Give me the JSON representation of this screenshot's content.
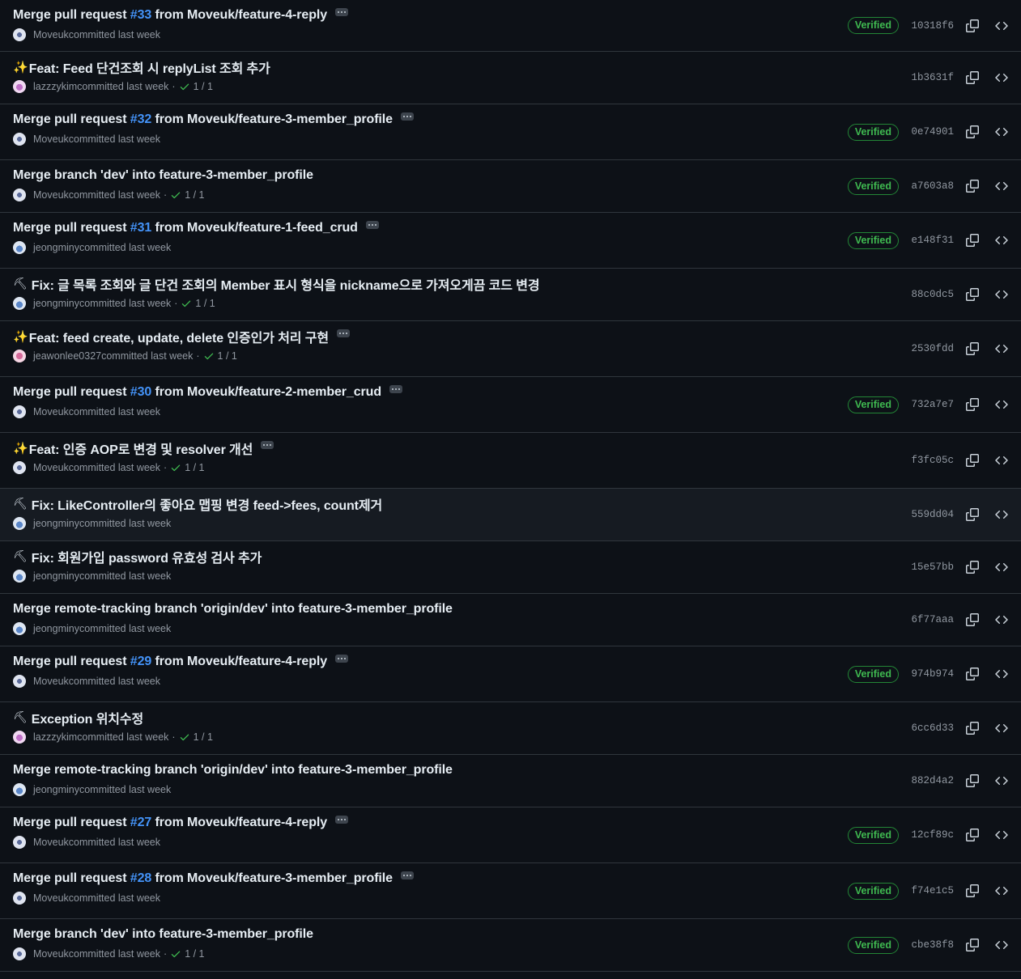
{
  "colors": {
    "background": "#0d1117",
    "highlight_row": "#161b22",
    "border": "#30363d",
    "text_primary": "#e6edf3",
    "text_muted": "#9198a1",
    "link_blue": "#4493f8",
    "verified_green": "#3fb950"
  },
  "labels": {
    "committed_suffix": "committed last week",
    "verified": "Verified"
  },
  "commits": [
    {
      "emoji": "",
      "prefix": "Merge pull request ",
      "pr": "#33",
      "suffix": " from Moveuk/feature-4-reply",
      "ellipsis": true,
      "avatar": "moveuk",
      "author": "Moveuk",
      "committed": "committed last week",
      "checks": "",
      "verified": true,
      "sha": "10318f6",
      "height": 64
    },
    {
      "emoji": "✨",
      "prefix": "Feat: Feed 단건조회 시 replyList 조회 추가",
      "pr": "",
      "suffix": "",
      "ellipsis": false,
      "avatar": "lazzzykim",
      "author": "lazzzykim",
      "committed": "committed last week",
      "checks": "1 / 1",
      "verified": false,
      "sha": "1b3631f",
      "height": 65
    },
    {
      "emoji": "",
      "prefix": "Merge pull request ",
      "pr": "#32",
      "suffix": " from Moveuk/feature-3-member_profile",
      "ellipsis": true,
      "avatar": "moveuk",
      "author": "Moveuk",
      "committed": "committed last week",
      "checks": "",
      "verified": true,
      "sha": "0e74901",
      "height": 69
    },
    {
      "emoji": "",
      "prefix": "Merge branch 'dev' into feature-3-member_profile",
      "pr": "",
      "suffix": "",
      "ellipsis": false,
      "avatar": "moveuk",
      "author": "Moveuk",
      "committed": "committed last week",
      "checks": "1 / 1",
      "verified": true,
      "sha": "a7603a8",
      "height": 65
    },
    {
      "emoji": "",
      "prefix": "Merge pull request ",
      "pr": "#31",
      "suffix": " from Moveuk/feature-1-feed_crud",
      "ellipsis": true,
      "avatar": "jeongminy",
      "author": "jeongminy",
      "committed": "committed last week",
      "checks": "",
      "verified": true,
      "sha": "e148f31",
      "height": 69
    },
    {
      "emoji": "⛏",
      "prefix": "Fix: 글 목록 조회와 글 단건 조회의 Member 표시 형식을 nickname으로 가져오게끔 코드 변경",
      "pr": "",
      "suffix": "",
      "ellipsis": false,
      "avatar": "jeongminy",
      "author": "jeongminy",
      "committed": "committed last week",
      "checks": "1 / 1",
      "verified": false,
      "sha": "88c0dc5",
      "height": 65
    },
    {
      "emoji": "✨",
      "prefix": "Feat: feed create, update, delete 인증인가 처리 구현",
      "pr": "",
      "suffix": "",
      "ellipsis": true,
      "avatar": "jeawonlee0327",
      "author": "jeawonlee0327",
      "committed": "committed last week",
      "checks": "1 / 1",
      "verified": false,
      "sha": "2530fdd",
      "height": 69
    },
    {
      "emoji": "",
      "prefix": "Merge pull request ",
      "pr": "#30",
      "suffix": " from Moveuk/feature-2-member_crud",
      "ellipsis": true,
      "avatar": "moveuk",
      "author": "Moveuk",
      "committed": "committed last week",
      "checks": "",
      "verified": true,
      "sha": "732a7e7",
      "height": 69
    },
    {
      "emoji": "✨",
      "prefix": "Feat: 인증 AOP로 변경 및 resolver 개선",
      "pr": "",
      "suffix": "",
      "ellipsis": true,
      "avatar": "moveuk",
      "author": "Moveuk",
      "committed": "committed last week",
      "checks": "1 / 1",
      "verified": false,
      "sha": "f3fc05c",
      "height": 69
    },
    {
      "emoji": "⛏",
      "prefix": "Fix: LikeController의 좋아요 맵핑 변경 feed->fees, count제거",
      "pr": "",
      "suffix": "",
      "ellipsis": false,
      "avatar": "jeongminy",
      "author": "jeongminy",
      "committed": "committed last week",
      "checks": "",
      "verified": false,
      "sha": "559dd04",
      "height": 65,
      "highlight": true
    },
    {
      "emoji": "⛏",
      "prefix": "Fix: 회원가입 password 유효성 검사 추가",
      "pr": "",
      "suffix": "",
      "ellipsis": false,
      "avatar": "jeongminy",
      "author": "jeongminy",
      "committed": "committed last week",
      "checks": "",
      "verified": false,
      "sha": "15e57bb",
      "height": 65
    },
    {
      "emoji": "",
      "prefix": "Merge remote-tracking branch 'origin/dev' into feature-3-member_profile",
      "pr": "",
      "suffix": "",
      "ellipsis": false,
      "avatar": "jeongminy",
      "author": "jeongminy",
      "committed": "committed last week",
      "checks": "",
      "verified": false,
      "sha": "6f77aaa",
      "height": 65
    },
    {
      "emoji": "",
      "prefix": "Merge pull request ",
      "pr": "#29",
      "suffix": " from Moveuk/feature-4-reply",
      "ellipsis": true,
      "avatar": "moveuk",
      "author": "Moveuk",
      "committed": "committed last week",
      "checks": "",
      "verified": true,
      "sha": "974b974",
      "height": 69
    },
    {
      "emoji": "⛏",
      "prefix": "Exception 위치수정",
      "pr": "",
      "suffix": "",
      "ellipsis": false,
      "avatar": "lazzzykim",
      "author": "lazzzykim",
      "committed": "committed last week",
      "checks": "1 / 1",
      "verified": false,
      "sha": "6cc6d33",
      "height": 65
    },
    {
      "emoji": "",
      "prefix": "Merge remote-tracking branch 'origin/dev' into feature-3-member_profile",
      "pr": "",
      "suffix": "",
      "ellipsis": false,
      "avatar": "jeongminy",
      "author": "jeongminy",
      "committed": "committed last week",
      "checks": "",
      "verified": false,
      "sha": "882d4a2",
      "height": 65
    },
    {
      "emoji": "",
      "prefix": "Merge pull request ",
      "pr": "#27",
      "suffix": " from Moveuk/feature-4-reply",
      "ellipsis": true,
      "avatar": "moveuk",
      "author": "Moveuk",
      "committed": "committed last week",
      "checks": "",
      "verified": true,
      "sha": "12cf89c",
      "height": 69
    },
    {
      "emoji": "",
      "prefix": "Merge pull request ",
      "pr": "#28",
      "suffix": " from Moveuk/feature-3-member_profile",
      "ellipsis": true,
      "avatar": "moveuk",
      "author": "Moveuk",
      "committed": "committed last week",
      "checks": "",
      "verified": true,
      "sha": "f74e1c5",
      "height": 69
    },
    {
      "emoji": "",
      "prefix": "Merge branch 'dev' into feature-3-member_profile",
      "pr": "",
      "suffix": "",
      "ellipsis": false,
      "avatar": "moveuk",
      "author": "Moveuk",
      "committed": "committed last week",
      "checks": "1 / 1",
      "verified": true,
      "sha": "cbe38f8",
      "height": 65
    }
  ]
}
